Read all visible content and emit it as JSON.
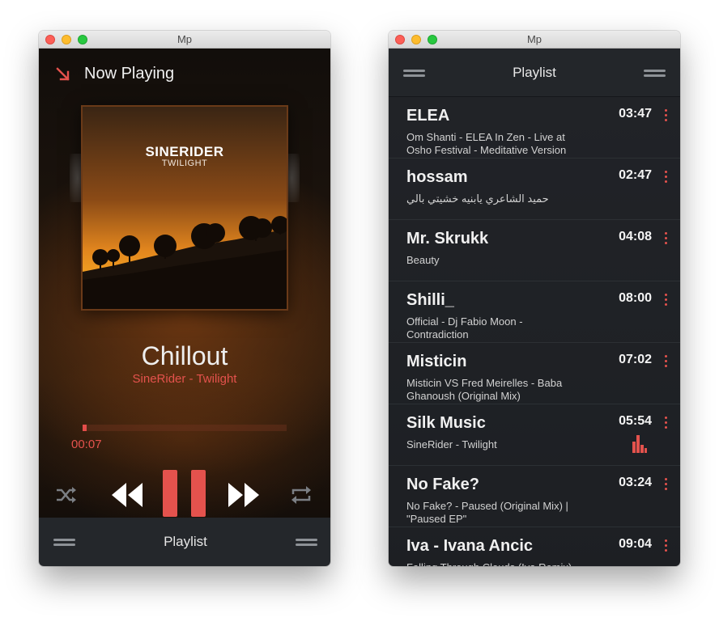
{
  "left_window": {
    "title": "Mp",
    "header": {
      "title": "Now Playing"
    },
    "album": {
      "brand": "SINERIDER",
      "subtitle": "TWILIGHT"
    },
    "track": {
      "name": "Chillout",
      "artist": "SineRider - Twilight"
    },
    "progress": {
      "elapsed": "00:07",
      "fraction": 0.02
    },
    "footer": {
      "label": "Playlist"
    },
    "colors": {
      "accent": "#e4524d"
    }
  },
  "right_window": {
    "title": "Mp",
    "header": {
      "title": "Playlist"
    },
    "items": [
      {
        "title": "ELEA",
        "subtitle": "Om Shanti - ELEA In Zen - Live at Osho Festival - Meditative Version",
        "duration": "03:47",
        "playing": false
      },
      {
        "title": "hossam",
        "subtitle": "حميد الشاعري يابنيه خشيتي بالي",
        "duration": "02:47",
        "playing": false
      },
      {
        "title": "Mr. Skrukk",
        "subtitle": "Beauty",
        "duration": "04:08",
        "playing": false
      },
      {
        "title": "Shilli_",
        "subtitle": "Official - Dj Fabio Moon - Contradiction",
        "duration": "08:00",
        "playing": false
      },
      {
        "title": "Misticin",
        "subtitle": "Misticin VS Fred Meirelles - Baba Ghanoush (Original Mix)",
        "duration": "07:02",
        "playing": false
      },
      {
        "title": "Silk Music",
        "subtitle": "SineRider - Twilight",
        "duration": "05:54",
        "playing": true
      },
      {
        "title": "No Fake?",
        "subtitle": "No Fake? - Paused (Original Mix) | \"Paused EP\"",
        "duration": "03:24",
        "playing": false
      },
      {
        "title": "Iva - Ivana Ancic",
        "subtitle": "Falling Through Clouds (Iva Remix)",
        "duration": "09:04",
        "playing": false
      }
    ]
  }
}
